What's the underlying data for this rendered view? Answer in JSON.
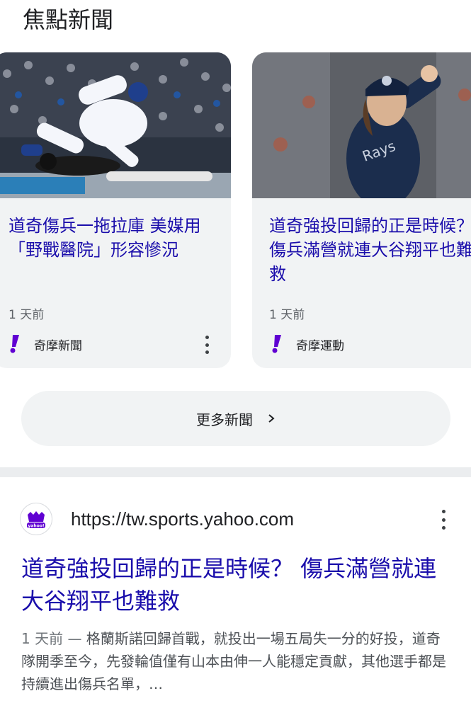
{
  "section": {
    "title": "焦點新聞"
  },
  "cards": [
    {
      "headline": "道奇傷兵一拖拉庫 美媒用「野戰醫院」形容慘況",
      "time": "1 天前",
      "source": "奇摩新聞"
    },
    {
      "headline": "道奇強投回歸的正是時候？ 傷兵滿營就連大谷翔平也難救",
      "time": "1 天前",
      "source": "奇摩運動"
    }
  ],
  "more_button": {
    "label": "更多新聞"
  },
  "result": {
    "url": "https://tw.sports.yahoo.com",
    "favicon_text": "yahoo!",
    "title": "道奇強投回歸的正是時候？ 傷兵滿營就連大谷翔平也難救",
    "date": "1 天前 — ",
    "snippet": "格蘭斯諾回歸首戰，就投出一場五局失一分的好投，道奇隊開季至今，先發輪值僅有山本由伸一人能穩定貢獻，其他選手都是持續進出傷兵名單，…"
  },
  "colors": {
    "link": "#1a0dab",
    "yahoo_purple": "#6001d2",
    "card_bg": "#f1f3f4"
  },
  "icons": [
    "yahoo-logo-icon",
    "more-vert-icon",
    "chevron-right-icon"
  ]
}
